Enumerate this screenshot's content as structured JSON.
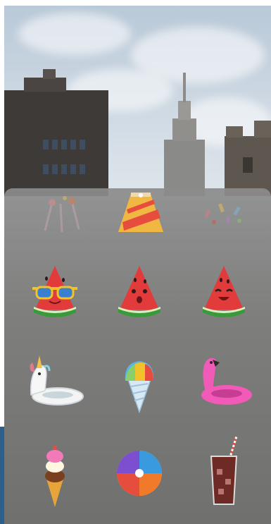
{
  "screen": {
    "background_photo": "city-skyline-with-empire-state-building",
    "accent_strip_color": "#2d5f8e",
    "tray_color": "#7b7b79"
  },
  "sticker_tray": {
    "stickers": [
      {
        "name": "party-popper-sticker",
        "row": 1,
        "col": 1
      },
      {
        "name": "party-hat-sticker",
        "row": 1,
        "col": 2
      },
      {
        "name": "confetti-sticker",
        "row": 1,
        "col": 3
      },
      {
        "name": "watermelon-sunglasses-sticker",
        "row": 2,
        "col": 1
      },
      {
        "name": "watermelon-surprised-sticker",
        "row": 2,
        "col": 2
      },
      {
        "name": "watermelon-smiling-sticker",
        "row": 2,
        "col": 3
      },
      {
        "name": "unicorn-pool-float-sticker",
        "row": 3,
        "col": 1
      },
      {
        "name": "snow-cone-sticker",
        "row": 3,
        "col": 2
      },
      {
        "name": "flamingo-pool-float-sticker",
        "row": 3,
        "col": 3
      },
      {
        "name": "ice-cream-cone-sticker",
        "row": 4,
        "col": 1
      },
      {
        "name": "beach-ball-sticker",
        "row": 4,
        "col": 2
      },
      {
        "name": "soda-glass-sticker",
        "row": 4,
        "col": 3
      }
    ]
  }
}
